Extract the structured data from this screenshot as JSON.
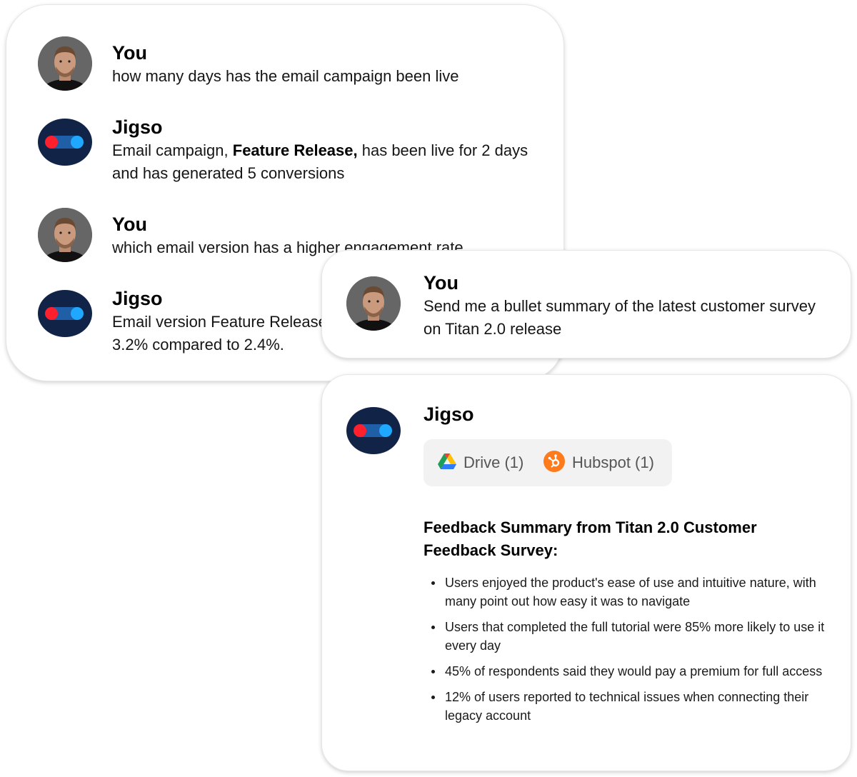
{
  "history": [
    {
      "sender": "You",
      "lines": [
        "how many days has the email campaign been live"
      ]
    },
    {
      "sender": "Jigso",
      "line1_pre": "Email campaign, ",
      "line1_bold": "Feature Release,",
      "line1_post": " has been live for 2 days",
      "line2": "and has generated 5 conversions"
    },
    {
      "sender": "You",
      "lines": [
        "which email version has a higher engagement rate"
      ]
    },
    {
      "sender": "Jigso",
      "lines": [
        "Email version Feature Release",
        "3.2% compared to 2.4%."
      ]
    }
  ],
  "question": {
    "sender": "You",
    "lines": [
      "Send me a bullet summary of the latest customer survey",
      "on Titan 2.0 release"
    ]
  },
  "answer": {
    "sender": "Jigso",
    "sources": [
      {
        "icon": "google-drive-icon",
        "label": "Drive (1)"
      },
      {
        "icon": "hubspot-icon",
        "label": "Hubspot (1)"
      }
    ],
    "summary_title": "Feedback Summary from Titan 2.0 Customer Feedback Survey:",
    "bullets": [
      "Users enjoyed the product's ease of use and intuitive nature, with many point out how easy it was to navigate",
      "Users that completed the full tutorial were 85% more likely to use it every day",
      "45% of respondents said they would pay a premium for full access",
      "12% of users reported to technical issues when connecting their legacy account"
    ]
  },
  "colors": {
    "bot_body": "#122348",
    "bot_dot_red": "#ff1f2d",
    "bot_dot_blue": "#1fa8ff",
    "hubspot": "#ff7a1a"
  }
}
